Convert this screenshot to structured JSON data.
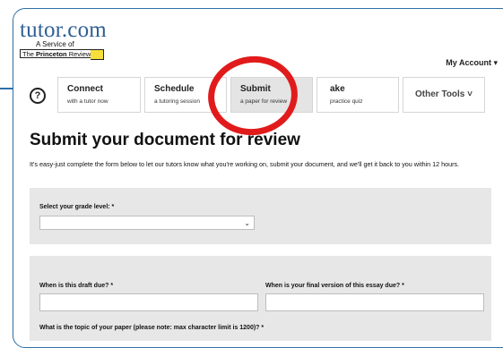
{
  "logo": {
    "main": "tutor.com",
    "sub": "A Service of",
    "brand_prefix": "The ",
    "brand_bold": "Princeton",
    "brand_suffix": " Review"
  },
  "header": {
    "account_label": "My Account",
    "account_caret": "▾"
  },
  "nav": {
    "help_icon": "?",
    "tabs": [
      {
        "title": "Connect",
        "subtitle": "with a tutor now"
      },
      {
        "title": "Schedule",
        "subtitle": "a tutoring session"
      },
      {
        "title": "Submit",
        "subtitle": "a paper for review"
      },
      {
        "title": "ake",
        "subtitle": "practice quiz"
      }
    ],
    "other_tools": "Other Tools ˅"
  },
  "main": {
    "title": "Submit your document for review",
    "intro": "It's easy-just complete the form below to let our tutors know what you're working on, submit your document, and we'll get it back to you within 12 hours."
  },
  "form": {
    "grade_label": "Select your grade level: *",
    "grade_value": "",
    "draft_due_label": "When is this draft due? *",
    "final_due_label": "When is your final version of this essay due? *",
    "topic_label": "What is the topic of your paper (please note: max character limit is 1200)? *"
  },
  "colors": {
    "frame_border": "#2d6fa6",
    "highlight_circle": "#e11b1b",
    "logo_blue": "#2f5f93",
    "panel_bg": "#e7e7e7",
    "active_tab_bg": "#e4e4e4"
  },
  "icons": {
    "help": "help-circle-icon",
    "account_caret": "chevron-down-icon",
    "select_chevron": "chevron-down-icon"
  }
}
